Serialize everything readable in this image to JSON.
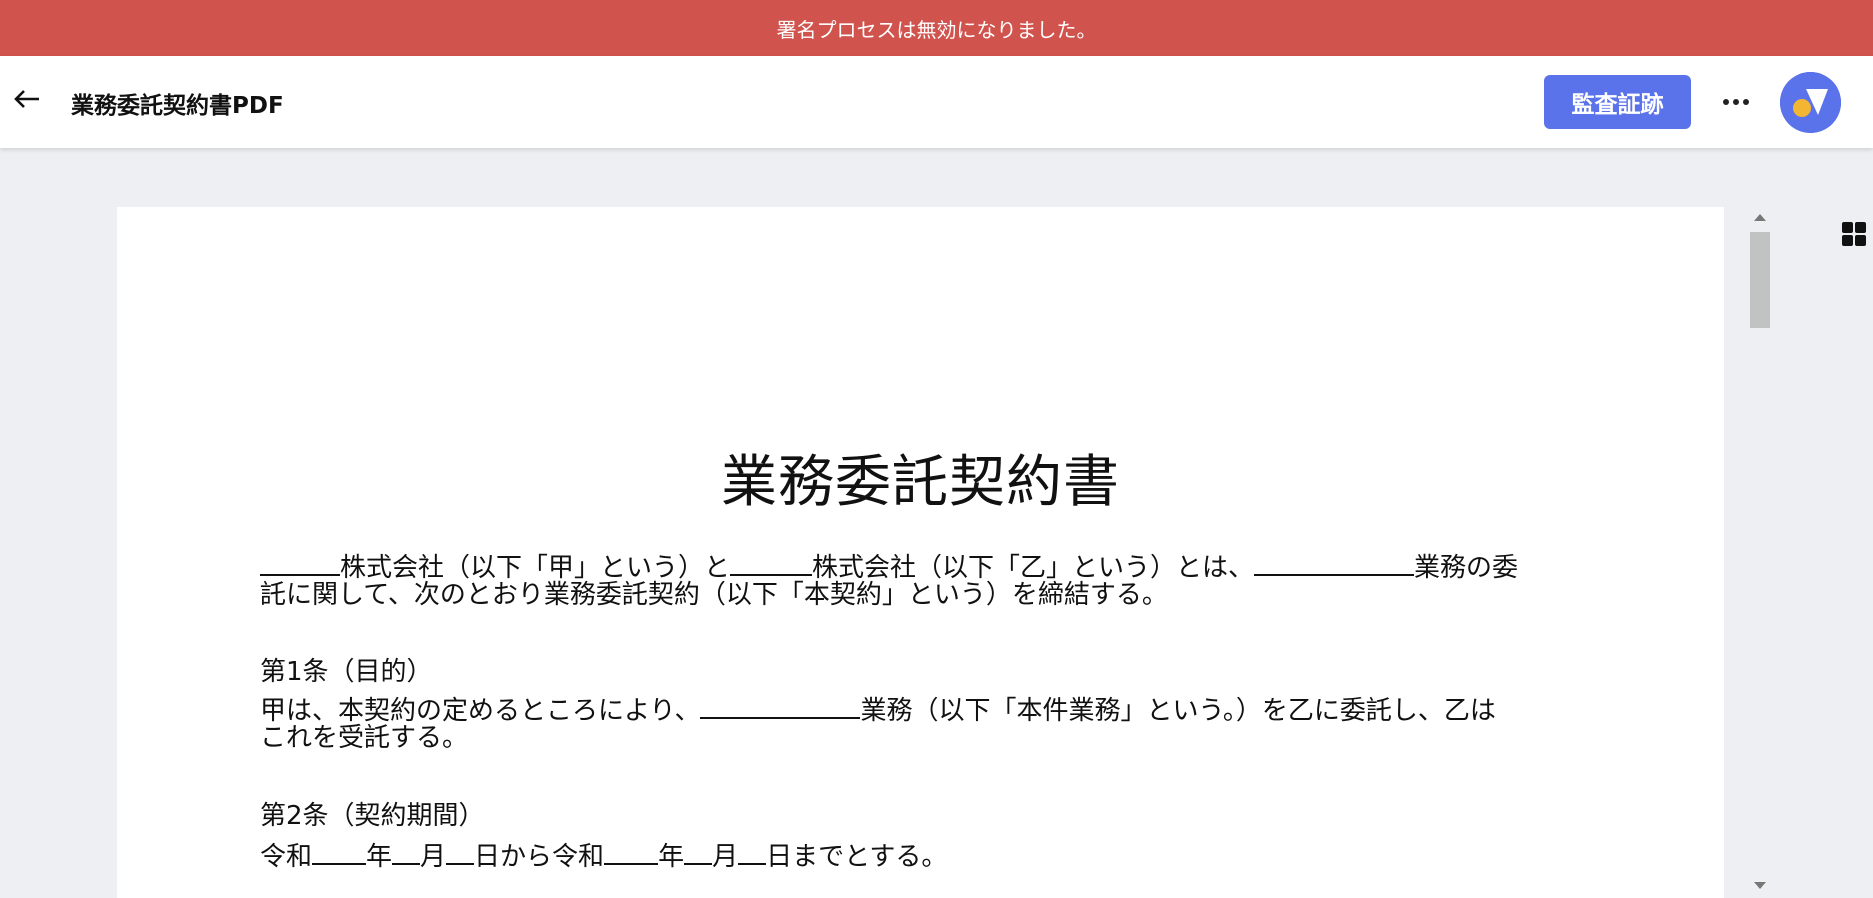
{
  "banner": {
    "message": "署名プロセスは無効になりました。",
    "color": "#d0534d"
  },
  "header": {
    "back_icon": "arrow-left-icon",
    "title": "業務委託契約書PDF",
    "audit_button_label": "監査証跡",
    "accent_color": "#5a72ea",
    "more_icon": "more-horizontal-icon",
    "avatar_icon": "brand-logo-avatar"
  },
  "document": {
    "heading": "業務委託契約書",
    "intro_line1_a": "株式会社（以下「甲」という）と",
    "intro_line1_b": "株式会社（以下「乙」という）とは、",
    "intro_line1_c": "業務の委",
    "intro_line2": "託に関して、次のとおり業務委託契約（以下「本契約」という）を締結する。",
    "article1_title": "第1条（目的）",
    "article1_line1_a": "甲は、本契約の定めるところにより、",
    "article1_line1_b": "業務（以下「本件業務」という。）を乙に委託し、乙は",
    "article1_line2": "これを受託する。",
    "article2_title": "第2条（契約期間）",
    "article2_a": "令和",
    "article2_b": "年",
    "article2_c": "月",
    "article2_d": "日から令和",
    "article2_e": "年",
    "article2_f": "月",
    "article2_g": "日までとする。"
  },
  "sidebar": {
    "grid_icon": "grid-view-icon"
  }
}
